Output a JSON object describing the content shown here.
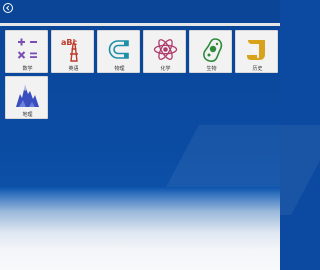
{
  "colors": {
    "background": "#0b4aa0",
    "tile_background": "#f2f2f2",
    "math": "#7a4fb5",
    "english": "#c0392b",
    "physics": "#1f8fa8",
    "chemistry": "#b03a6b",
    "biology": "#2e8b3e",
    "history": "#d9a21b",
    "geography": "#3a4fbf"
  },
  "topbar": {
    "back_icon": "back-circle-icon"
  },
  "subjects": [
    {
      "label": "数学",
      "icon": "math-icon"
    },
    {
      "label": "英语",
      "icon": "abc-eiffel-tower-icon"
    },
    {
      "label": "物理",
      "icon": "magnet-icon"
    },
    {
      "label": "化学",
      "icon": "atom-icon"
    },
    {
      "label": "生物",
      "icon": "cell-icon"
    },
    {
      "label": "历史",
      "icon": "scroll-icon"
    },
    {
      "label": "地理",
      "icon": "mountain-icon"
    }
  ]
}
